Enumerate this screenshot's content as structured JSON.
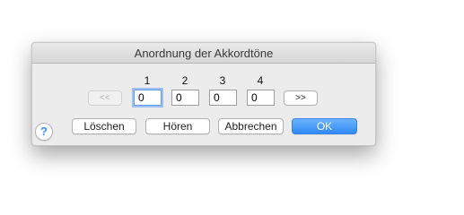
{
  "dialog": {
    "title": "Anordnung der Akkordtöne",
    "columns": [
      "1",
      "2",
      "3",
      "4"
    ],
    "fields": [
      {
        "value": "0",
        "focused": true
      },
      {
        "value": "0",
        "focused": false
      },
      {
        "value": "0",
        "focused": false
      },
      {
        "value": "0",
        "focused": false
      }
    ],
    "prev_label": "<<",
    "next_label": ">>",
    "buttons": {
      "clear": "Löschen",
      "listen": "Hören",
      "cancel": "Abbrechen",
      "ok": "OK"
    },
    "help_label": "?",
    "colors": {
      "primary": "#2f8af6",
      "focus_ring": "#9cc0f2",
      "help_icon": "#3a8ef2"
    }
  }
}
